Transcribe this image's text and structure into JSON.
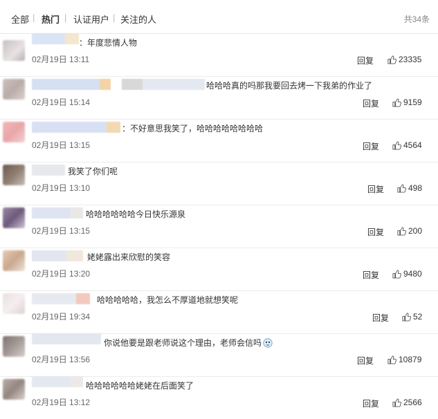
{
  "tabs": [
    {
      "label": "全部"
    },
    {
      "label": "热门"
    },
    {
      "label": "认证用户"
    },
    {
      "label": "关注的人"
    }
  ],
  "tab_separator": "|",
  "total_label": "共34条",
  "colors": {
    "border": "#ececec",
    "text": "#333333",
    "time": "#666666"
  },
  "comments": [
    {
      "text": "：年度悲情人物",
      "time": "02月19日 13:11",
      "reply": "回复",
      "likes": "23335"
    },
    {
      "text": "哈哈哈真的吗那我要回去烤一下我弟的作业了",
      "time": "02月19日 15:14",
      "reply": "回复",
      "likes": "9159"
    },
    {
      "text": "：不好意思我笑了，哈哈哈哈哈哈哈哈",
      "time": "02月19日 13:15",
      "reply": "回复",
      "likes": "4564"
    },
    {
      "text": "我笑了你们呢",
      "time": "02月19日 13:10",
      "reply": "回复",
      "likes": "498"
    },
    {
      "text": "哈哈哈哈哈哈今日快乐源泉",
      "time": "02月19日 13:15",
      "reply": "回复",
      "likes": "200"
    },
    {
      "text": "姥姥露出来欣慰的笑容",
      "time": "02月19日 13:20",
      "reply": "回复",
      "likes": "9480"
    },
    {
      "text": "哈哈哈哈哈，我怎么不厚道地就想笑呢",
      "time": "02月19日 19:34",
      "reply": "回复",
      "likes": "52"
    },
    {
      "text": "你说他要是跟老师说这个理由，老师会信吗",
      "time": "02月19日 13:56",
      "reply": "回复",
      "likes": "10879"
    },
    {
      "text": "哈哈哈哈哈哈姥姥在后面笑了",
      "time": "02月19日 13:12",
      "reply": "回复",
      "likes": "2566"
    }
  ]
}
